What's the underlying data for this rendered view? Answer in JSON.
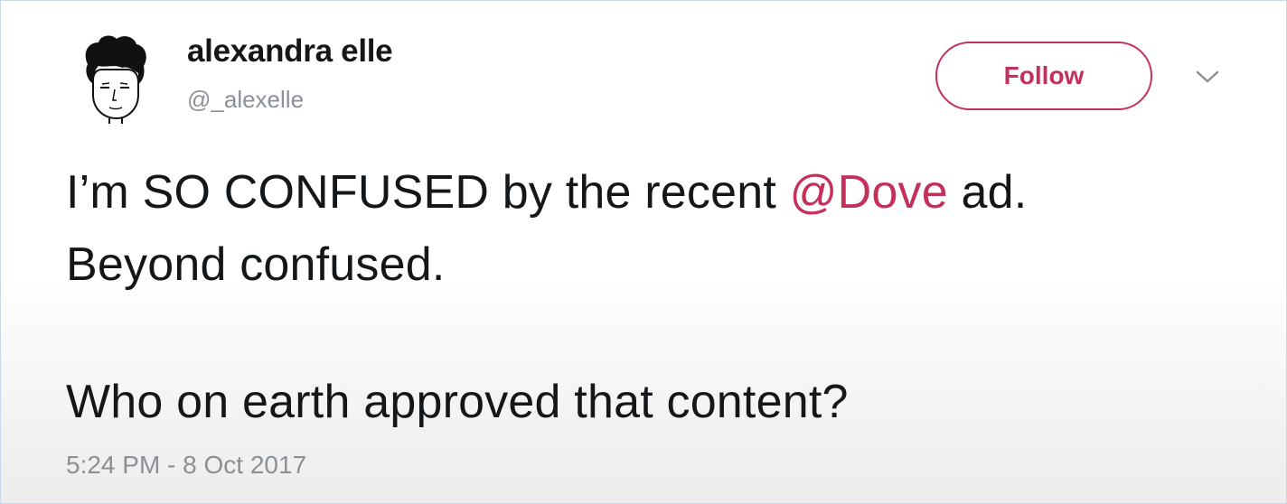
{
  "author": {
    "name": "alexandra elle",
    "handle": "@_alexelle"
  },
  "follow_button": {
    "label": "Follow"
  },
  "icons": {
    "avatar": "avatar-illustration",
    "caret": "chevron-down-icon"
  },
  "tweet": {
    "line1_before": "I’m SO CONFUSED by the recent ",
    "mention": "@Dove",
    "line1_after": " ad.",
    "line2": "Beyond confused.",
    "line3": "Who on earth approved that content?"
  },
  "timestamp": "5:24 PM - 8 Oct 2017",
  "colors": {
    "accent": "#c5305a",
    "text": "#14171a",
    "muted": "#8a9096",
    "border": "#c9d6e6"
  }
}
